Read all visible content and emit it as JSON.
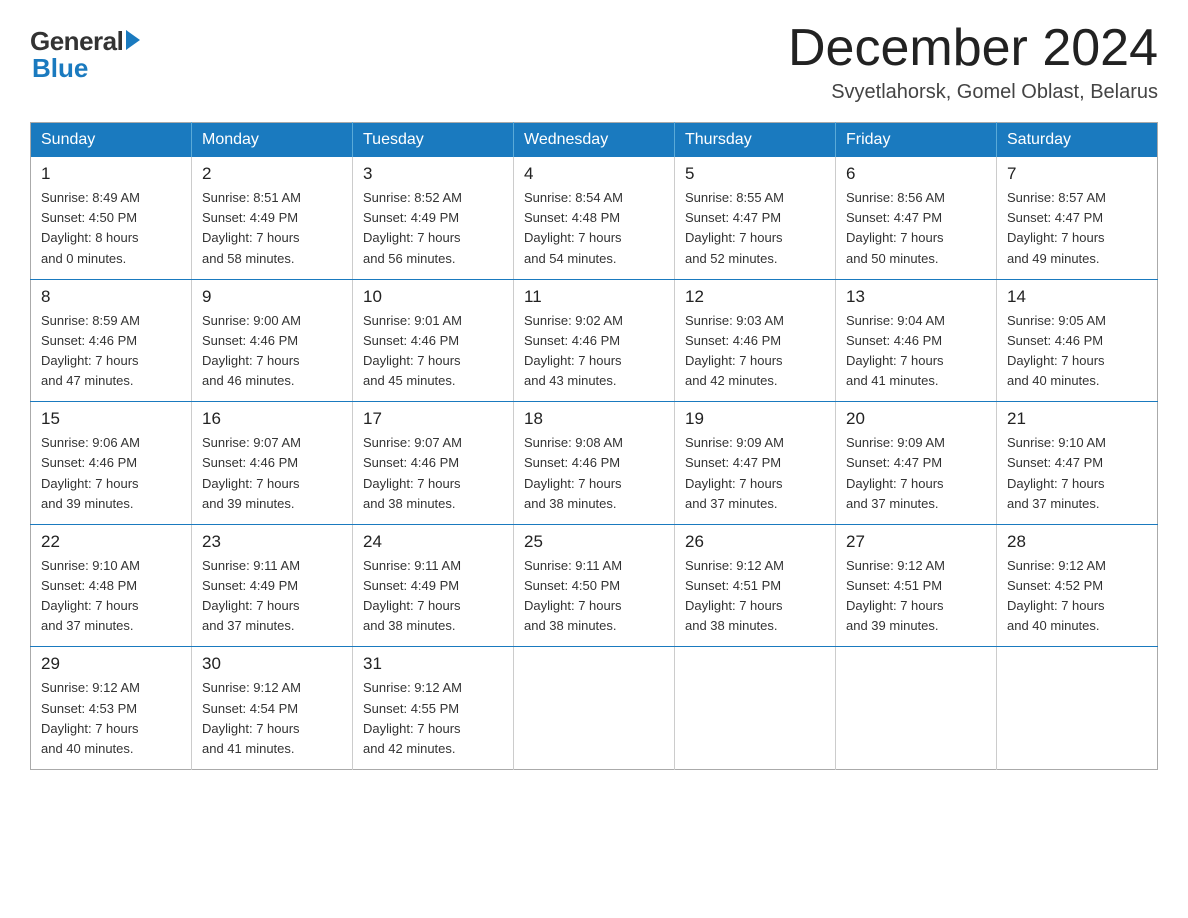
{
  "logo": {
    "general": "General",
    "blue": "Blue"
  },
  "header": {
    "month_title": "December 2024",
    "location": "Svyetlahorsk, Gomel Oblast, Belarus"
  },
  "weekdays": [
    "Sunday",
    "Monday",
    "Tuesday",
    "Wednesday",
    "Thursday",
    "Friday",
    "Saturday"
  ],
  "weeks": [
    [
      {
        "day": "1",
        "info": "Sunrise: 8:49 AM\nSunset: 4:50 PM\nDaylight: 8 hours\nand 0 minutes."
      },
      {
        "day": "2",
        "info": "Sunrise: 8:51 AM\nSunset: 4:49 PM\nDaylight: 7 hours\nand 58 minutes."
      },
      {
        "day": "3",
        "info": "Sunrise: 8:52 AM\nSunset: 4:49 PM\nDaylight: 7 hours\nand 56 minutes."
      },
      {
        "day": "4",
        "info": "Sunrise: 8:54 AM\nSunset: 4:48 PM\nDaylight: 7 hours\nand 54 minutes."
      },
      {
        "day": "5",
        "info": "Sunrise: 8:55 AM\nSunset: 4:47 PM\nDaylight: 7 hours\nand 52 minutes."
      },
      {
        "day": "6",
        "info": "Sunrise: 8:56 AM\nSunset: 4:47 PM\nDaylight: 7 hours\nand 50 minutes."
      },
      {
        "day": "7",
        "info": "Sunrise: 8:57 AM\nSunset: 4:47 PM\nDaylight: 7 hours\nand 49 minutes."
      }
    ],
    [
      {
        "day": "8",
        "info": "Sunrise: 8:59 AM\nSunset: 4:46 PM\nDaylight: 7 hours\nand 47 minutes."
      },
      {
        "day": "9",
        "info": "Sunrise: 9:00 AM\nSunset: 4:46 PM\nDaylight: 7 hours\nand 46 minutes."
      },
      {
        "day": "10",
        "info": "Sunrise: 9:01 AM\nSunset: 4:46 PM\nDaylight: 7 hours\nand 45 minutes."
      },
      {
        "day": "11",
        "info": "Sunrise: 9:02 AM\nSunset: 4:46 PM\nDaylight: 7 hours\nand 43 minutes."
      },
      {
        "day": "12",
        "info": "Sunrise: 9:03 AM\nSunset: 4:46 PM\nDaylight: 7 hours\nand 42 minutes."
      },
      {
        "day": "13",
        "info": "Sunrise: 9:04 AM\nSunset: 4:46 PM\nDaylight: 7 hours\nand 41 minutes."
      },
      {
        "day": "14",
        "info": "Sunrise: 9:05 AM\nSunset: 4:46 PM\nDaylight: 7 hours\nand 40 minutes."
      }
    ],
    [
      {
        "day": "15",
        "info": "Sunrise: 9:06 AM\nSunset: 4:46 PM\nDaylight: 7 hours\nand 39 minutes."
      },
      {
        "day": "16",
        "info": "Sunrise: 9:07 AM\nSunset: 4:46 PM\nDaylight: 7 hours\nand 39 minutes."
      },
      {
        "day": "17",
        "info": "Sunrise: 9:07 AM\nSunset: 4:46 PM\nDaylight: 7 hours\nand 38 minutes."
      },
      {
        "day": "18",
        "info": "Sunrise: 9:08 AM\nSunset: 4:46 PM\nDaylight: 7 hours\nand 38 minutes."
      },
      {
        "day": "19",
        "info": "Sunrise: 9:09 AM\nSunset: 4:47 PM\nDaylight: 7 hours\nand 37 minutes."
      },
      {
        "day": "20",
        "info": "Sunrise: 9:09 AM\nSunset: 4:47 PM\nDaylight: 7 hours\nand 37 minutes."
      },
      {
        "day": "21",
        "info": "Sunrise: 9:10 AM\nSunset: 4:47 PM\nDaylight: 7 hours\nand 37 minutes."
      }
    ],
    [
      {
        "day": "22",
        "info": "Sunrise: 9:10 AM\nSunset: 4:48 PM\nDaylight: 7 hours\nand 37 minutes."
      },
      {
        "day": "23",
        "info": "Sunrise: 9:11 AM\nSunset: 4:49 PM\nDaylight: 7 hours\nand 37 minutes."
      },
      {
        "day": "24",
        "info": "Sunrise: 9:11 AM\nSunset: 4:49 PM\nDaylight: 7 hours\nand 38 minutes."
      },
      {
        "day": "25",
        "info": "Sunrise: 9:11 AM\nSunset: 4:50 PM\nDaylight: 7 hours\nand 38 minutes."
      },
      {
        "day": "26",
        "info": "Sunrise: 9:12 AM\nSunset: 4:51 PM\nDaylight: 7 hours\nand 38 minutes."
      },
      {
        "day": "27",
        "info": "Sunrise: 9:12 AM\nSunset: 4:51 PM\nDaylight: 7 hours\nand 39 minutes."
      },
      {
        "day": "28",
        "info": "Sunrise: 9:12 AM\nSunset: 4:52 PM\nDaylight: 7 hours\nand 40 minutes."
      }
    ],
    [
      {
        "day": "29",
        "info": "Sunrise: 9:12 AM\nSunset: 4:53 PM\nDaylight: 7 hours\nand 40 minutes."
      },
      {
        "day": "30",
        "info": "Sunrise: 9:12 AM\nSunset: 4:54 PM\nDaylight: 7 hours\nand 41 minutes."
      },
      {
        "day": "31",
        "info": "Sunrise: 9:12 AM\nSunset: 4:55 PM\nDaylight: 7 hours\nand 42 minutes."
      },
      {
        "day": "",
        "info": ""
      },
      {
        "day": "",
        "info": ""
      },
      {
        "day": "",
        "info": ""
      },
      {
        "day": "",
        "info": ""
      }
    ]
  ]
}
